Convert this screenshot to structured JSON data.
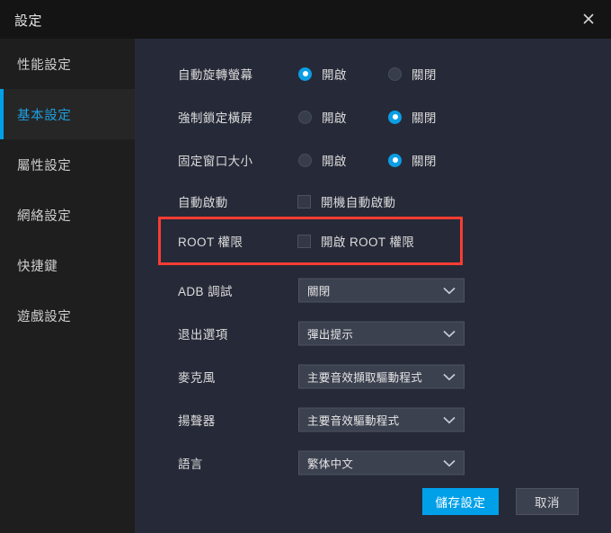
{
  "window": {
    "title": "設定",
    "close_icon": "close-icon"
  },
  "sidebar": {
    "items": [
      {
        "label": "性能設定",
        "active": false
      },
      {
        "label": "基本設定",
        "active": true
      },
      {
        "label": "屬性設定",
        "active": false
      },
      {
        "label": "網絡設定",
        "active": false
      },
      {
        "label": "快捷鍵",
        "active": false
      },
      {
        "label": "遊戲設定",
        "active": false
      }
    ]
  },
  "settings": {
    "radio_rows": [
      {
        "label": "自動旋轉螢幕",
        "options": [
          {
            "label": "開啟",
            "selected": true
          },
          {
            "label": "關閉",
            "selected": false
          }
        ]
      },
      {
        "label": "強制鎖定橫屏",
        "options": [
          {
            "label": "開啟",
            "selected": false
          },
          {
            "label": "關閉",
            "selected": true
          }
        ]
      },
      {
        "label": "固定窗口大小",
        "options": [
          {
            "label": "開啟",
            "selected": false
          },
          {
            "label": "關閉",
            "selected": true
          }
        ]
      }
    ],
    "checkbox_rows": [
      {
        "label": "自動啟動",
        "checkbox_label": "開機自動啟動",
        "checked": false
      },
      {
        "label": "ROOT 權限",
        "checkbox_label": "開啟 ROOT 權限",
        "checked": false
      }
    ],
    "dropdown_rows": [
      {
        "label": "ADB 調試",
        "value": "關閉"
      },
      {
        "label": "退出選項",
        "value": "彈出提示"
      },
      {
        "label": "麥克風",
        "value": "主要音效擷取驅動程式"
      },
      {
        "label": "揚聲器",
        "value": "主要音效驅動程式"
      },
      {
        "label": "語言",
        "value": "繁体中文"
      }
    ]
  },
  "footer": {
    "save_label": "儲存設定",
    "cancel_label": "取消"
  },
  "colors": {
    "accent": "#00a0e9",
    "radio_on": "#0b9ee4",
    "highlight": "#f93c33",
    "titlebar_bg": "#141414",
    "sidebar_bg": "#1e1e1e",
    "content_bg": "#262a38",
    "dropdown_bg": "#3c4150"
  }
}
